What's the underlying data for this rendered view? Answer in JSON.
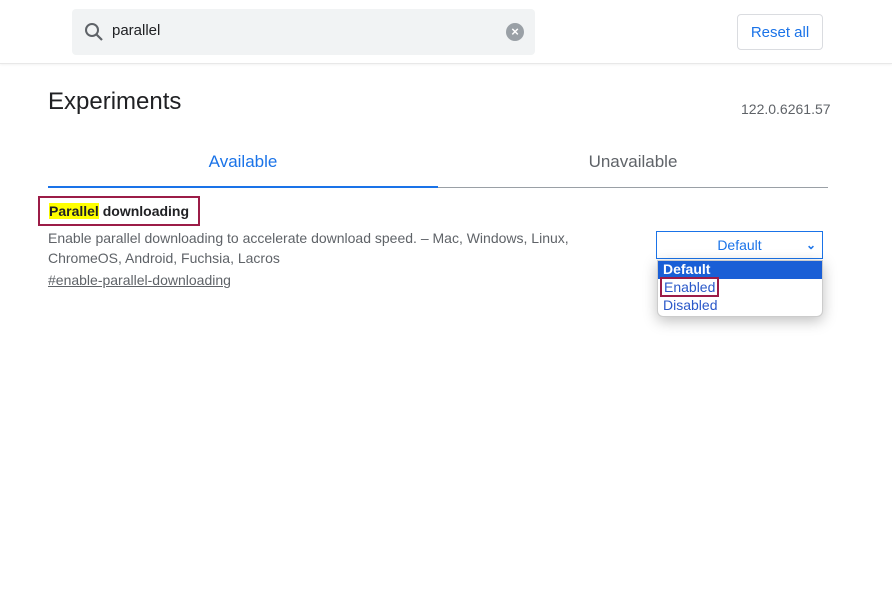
{
  "header": {
    "search_value": "parallel",
    "search_icon": "search-icon",
    "clear_icon": "clear-icon",
    "reset_label": "Reset all"
  },
  "page": {
    "title": "Experiments",
    "version": "122.0.6261.57"
  },
  "tabs": [
    {
      "label": "Available",
      "active": true
    },
    {
      "label": "Unavailable",
      "active": false
    }
  ],
  "experiment": {
    "name_highlight": "Parallel",
    "name_rest": " downloading",
    "description": "Enable parallel downloading to accelerate download speed. – Mac, Windows, Linux, ChromeOS, Android, Fuchsia, Lacros",
    "link": "#enable-parallel-downloading",
    "selected": "Default",
    "options": [
      "Default",
      "Enabled",
      "Disabled"
    ]
  },
  "colors": {
    "accent": "#1a73e8",
    "highlight": "#ffff00",
    "annotation": "#9c1c47"
  }
}
